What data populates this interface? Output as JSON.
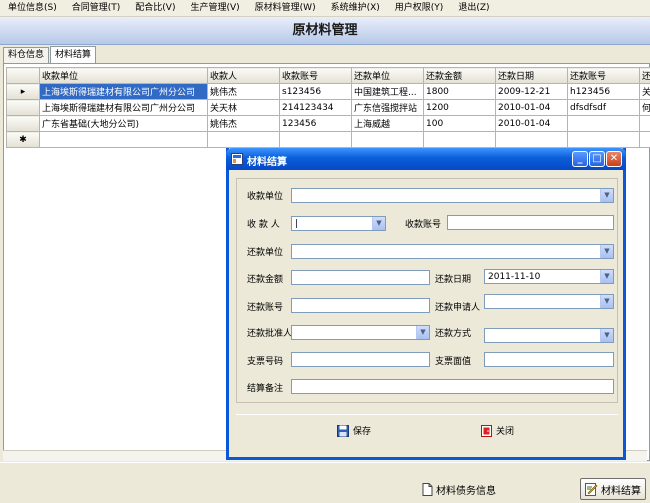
{
  "menu": [
    "单位信息(S)",
    "合同管理(T)",
    "配合比(V)",
    "生产管理(V)",
    "原材料管理(W)",
    "系统维护(X)",
    "用户权限(Y)",
    "退出(Z)"
  ],
  "header": {
    "title": "原材料管理"
  },
  "tabs": [
    "料仓信息",
    "材料结算"
  ],
  "grid": {
    "columns": [
      "收款单位",
      "收款人",
      "收款账号",
      "还款单位",
      "还款金额",
      "还款日期",
      "还款账号",
      "还"
    ],
    "rows": [
      [
        "上海埃斯得瑞建材有限公司广州分公司",
        "姚伟杰",
        "s123456",
        "中国建筑工程...",
        "1800",
        "2009-12-21",
        "h123456",
        "关"
      ],
      [
        "上海埃斯得瑞建材有限公司广州分公司",
        "关天林",
        "214123434",
        "广东信强搅拌站",
        "1200",
        "2010-01-04",
        "dfsdfsdf",
        "何"
      ],
      [
        "广东省基础(大地分公司)",
        "姚伟杰",
        "123456",
        "上海威越",
        "100",
        "2010-01-04",
        "",
        ""
      ]
    ],
    "current_row_marker": "▸",
    "new_row_marker": "✱"
  },
  "dialog": {
    "title": "材料结算",
    "fields": {
      "payee_unit_label": "收款单位",
      "payee_label": "收 款 人",
      "payee_account_label": "收款账号",
      "repay_unit_label": "还款单位",
      "repay_amount_label": "还款金额",
      "repay_date_label": "还款日期",
      "repay_date_value": "2011-11-10",
      "repay_account_label": "还款账号",
      "repay_applicant_label": "还款申请人",
      "repay_approver_label": "还款批准人",
      "repay_method_label": "还款方式",
      "check_number_label": "支票号码",
      "check_face_label": "支票面值",
      "settle_note_label": "结算备注"
    },
    "save_label": "保存",
    "close_label": "关闭"
  },
  "bottom": {
    "debt_info_label": "材料债务信息",
    "settle_label": "材料结算"
  }
}
